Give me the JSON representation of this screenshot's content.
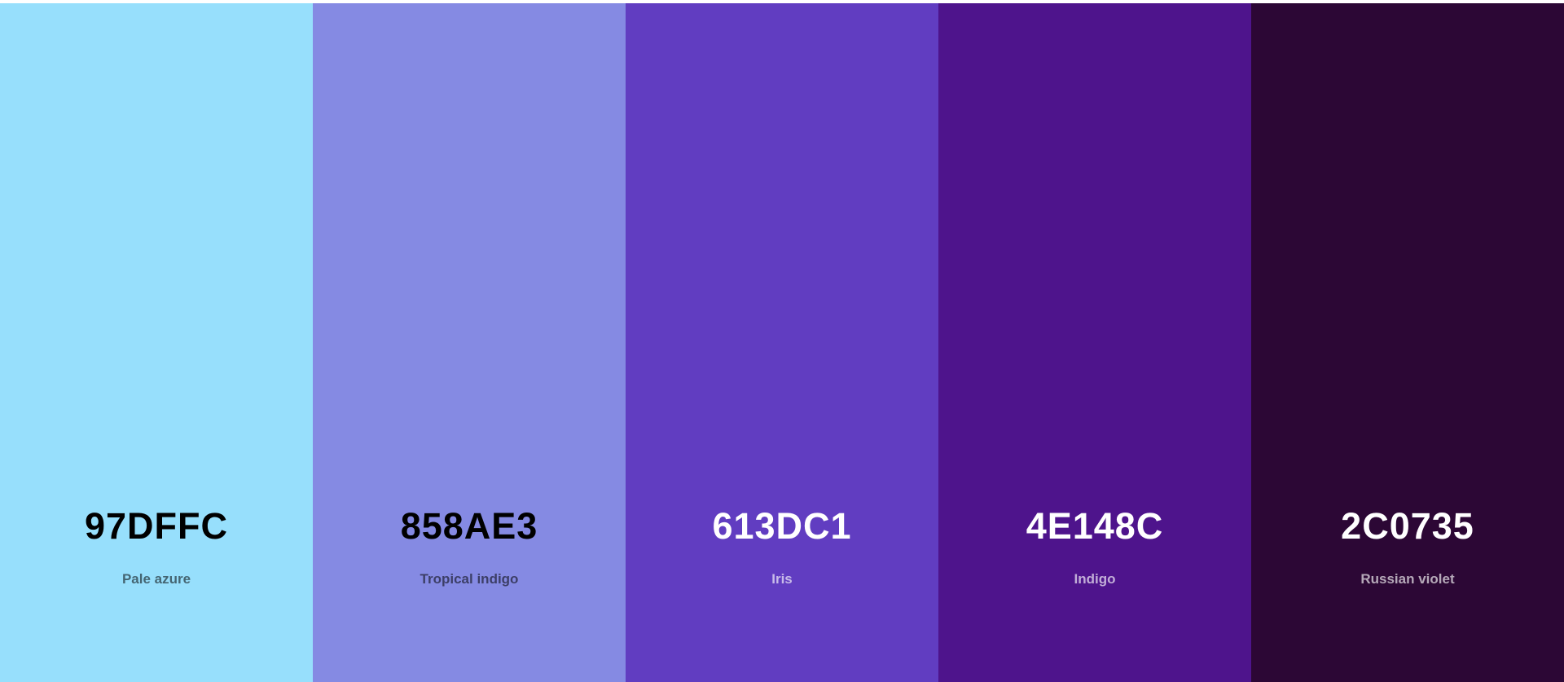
{
  "palette": {
    "swatches": [
      {
        "hex": "97DFFC",
        "name": "Pale azure",
        "color": "#97DFFC",
        "tone": "light"
      },
      {
        "hex": "858AE3",
        "name": "Tropical indigo",
        "color": "#858AE3",
        "tone": "light"
      },
      {
        "hex": "613DC1",
        "name": "Iris",
        "color": "#613DC1",
        "tone": "dark"
      },
      {
        "hex": "4E148C",
        "name": "Indigo",
        "color": "#4E148C",
        "tone": "dark"
      },
      {
        "hex": "2C0735",
        "name": "Russian violet",
        "color": "#2C0735",
        "tone": "dark"
      }
    ]
  }
}
